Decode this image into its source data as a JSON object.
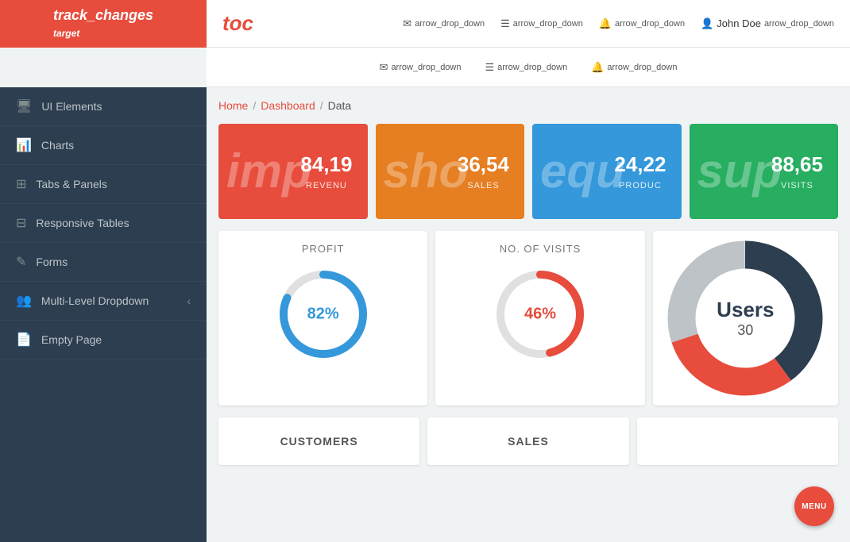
{
  "logo": {
    "main": "track_changes",
    "sub": "target"
  },
  "brand": {
    "title": "toc"
  },
  "nav": {
    "items": [
      {
        "icon": "✉",
        "label": "arrow_drop_down"
      },
      {
        "icon": "☰",
        "label": "arrow_drop_down"
      },
      {
        "icon": "🔔",
        "label": "arrow_drop_down"
      },
      {
        "icon": "👤",
        "label": "John Doe",
        "extra": "arrow_drop_down"
      }
    ]
  },
  "subheader": {
    "items": [
      {
        "icon": "✉",
        "label": "arrow_drop_down"
      },
      {
        "icon": "☰",
        "label": "arrow_drop_down"
      },
      {
        "icon": "🔔",
        "label": "arrow_drop_down"
      }
    ]
  },
  "sidebar": {
    "items": [
      {
        "icon": "🖥",
        "label": "UI Elements"
      },
      {
        "icon": "📊",
        "label": "Charts"
      },
      {
        "icon": "⊞",
        "label": "Tabs & Panels"
      },
      {
        "icon": "⊟",
        "label": "Responsive Tables"
      },
      {
        "icon": "✎",
        "label": "Forms"
      },
      {
        "icon": "👥",
        "label": "Multi-Level Dropdown",
        "arrow": "‹"
      },
      {
        "icon": "📄",
        "label": "Empty Page"
      }
    ]
  },
  "breadcrumb": {
    "home": "Home",
    "dashboard": "Dashboard",
    "current": "Data"
  },
  "stats": [
    {
      "bg_icon": "imp",
      "value": "84,19",
      "label": "REVENU",
      "color": "card-red"
    },
    {
      "bg_icon": "sho",
      "value": "36,54",
      "label": "SALES",
      "color": "card-orange"
    },
    {
      "bg_icon": "equ",
      "value": "24,22",
      "label": "PRODUC",
      "color": "card-blue"
    },
    {
      "bg_icon": "sup",
      "value": "88,65",
      "label": "VISITS",
      "color": "card-green"
    }
  ],
  "charts": {
    "profit": {
      "title": "PROFIT",
      "value": "82%",
      "percent": 82,
      "color": "#3498db",
      "track": "#e0e0e0"
    },
    "visits": {
      "title": "NO. OF VISITS",
      "value": "46%",
      "percent": 46,
      "color": "#e74c3c",
      "track": "#e0e0e0"
    },
    "users": {
      "title": "Users",
      "count": "30",
      "segments": [
        {
          "color": "#2c3e50",
          "value": 40
        },
        {
          "color": "#e74c3c",
          "value": 30
        },
        {
          "color": "#bdc3c7",
          "value": 30
        }
      ]
    }
  },
  "bottom": {
    "customers": "CUSTOMERS",
    "sales": "SALES"
  },
  "fab": {
    "label": "MENU"
  }
}
